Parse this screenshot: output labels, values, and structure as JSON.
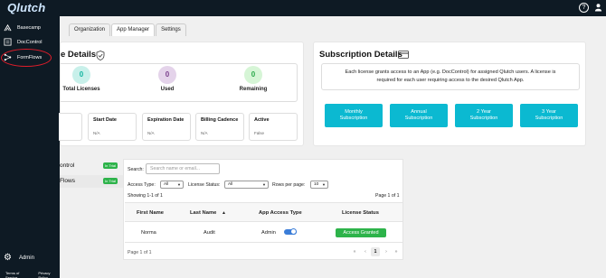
{
  "app": {
    "logo": "Qlutch"
  },
  "topbar": {
    "help_icon": "question-circle-icon",
    "user_icon": "user-icon"
  },
  "sidebar": {
    "items": [
      {
        "label": "Basecamp",
        "icon": "basecamp-icon"
      },
      {
        "label": "DocControl",
        "icon": "doc-icon"
      },
      {
        "label": "FormFlows",
        "icon": "formflows-icon"
      }
    ],
    "admin_label": "Admin",
    "footer": {
      "terms": "Terms of Service",
      "privacy": "Privacy Policy"
    },
    "highlight_color": "#e01d2a"
  },
  "tabs": [
    {
      "label": "Organization",
      "active": false
    },
    {
      "label": "App Manager",
      "active": true
    },
    {
      "label": "Settings",
      "active": false
    }
  ],
  "license": {
    "title": "e Details",
    "stats": [
      {
        "value": "0",
        "label": "Total Licenses",
        "color": "#c8f0ea"
      },
      {
        "value": "0",
        "label": "Used",
        "color": "#e4d3ea"
      },
      {
        "value": "0",
        "label": "Remaining",
        "color": "#d6f5d6"
      }
    ],
    "fields": [
      {
        "header": "Start Date",
        "value": "N/A"
      },
      {
        "header": "Expiration Date",
        "value": "N/A"
      },
      {
        "header": "Billing Cadence",
        "value": "N/A"
      },
      {
        "header": "Active",
        "value": "False"
      }
    ]
  },
  "subscription": {
    "title": "Subscription Details",
    "description_line1": "Each license grants access to an App (e.g. DocControl) for assigned Qlutch users. A license is",
    "description_line2": "required for each user requiring access to the desired Qlutch App.",
    "plans": [
      {
        "line1": "Monthly",
        "line2": "Subscription"
      },
      {
        "line1": "Annual",
        "line2": "Subscription"
      },
      {
        "line1": "2 Year",
        "line2": "Subscription"
      },
      {
        "line1": "3 Year",
        "line2": "Subscription"
      }
    ],
    "accent": "#0bb9d1"
  },
  "apps": [
    {
      "name": "ontrol",
      "badge": "In Trial",
      "selected": false
    },
    {
      "name": "Flows",
      "badge": "In Trial",
      "selected": true
    }
  ],
  "users": {
    "search_label": "Search:",
    "search_placeholder": "Search name or email...",
    "access_type_label": "Access Type:",
    "access_type_value": "All",
    "license_status_label": "License Status:",
    "license_status_value": "All",
    "rows_label": "Rows per page:",
    "rows_value": "10",
    "showing": "Showing 1-1 of 1",
    "page_top": "Page 1 of 1",
    "columns": [
      "First Name",
      "Last Name",
      "App Access Type",
      "License Status"
    ],
    "sort_indicator": "▲",
    "rows": [
      {
        "first": "Norma",
        "last": "Audit",
        "access": "Admin",
        "status": "Access Granted"
      }
    ],
    "page_bottom": "Page 1 of 1",
    "pager": {
      "first": "«",
      "prev": "‹",
      "current": "1",
      "next": "›",
      "last": "»"
    }
  }
}
